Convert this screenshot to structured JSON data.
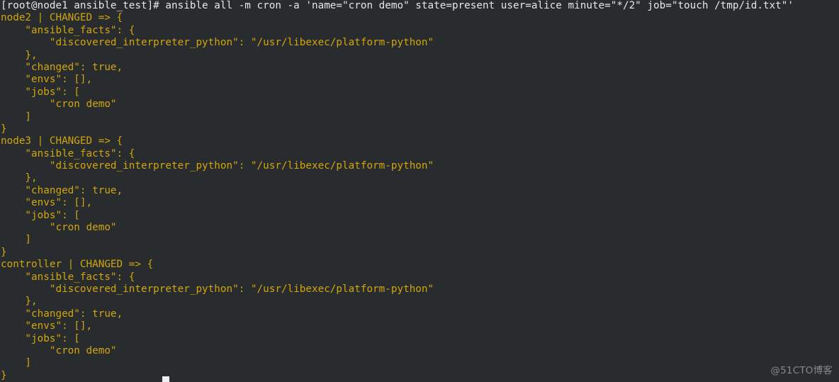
{
  "terminal": {
    "background_color": "#282c2e",
    "prompt_color": "#e6e8e6",
    "output_color": "#d2a50d",
    "prompt_line": "[root@node1 ansible_test]# ansible all -m cron -a 'name=\"cron demo\" state=present user=alice minute=\"*/2\" job=\"touch /tmp/id.txt\"'",
    "prompt": {
      "user": "root",
      "host": "node1",
      "directory": "ansible_test",
      "symbol": "#",
      "command": "ansible all -m cron -a 'name=\"cron demo\" state=present user=alice minute=\"*/2\" job=\"touch /tmp/id.txt\"'"
    },
    "output_lines": [
      "node2 | CHANGED => {",
      "    \"ansible_facts\": {",
      "        \"discovered_interpreter_python\": \"/usr/libexec/platform-python\"",
      "    },",
      "    \"changed\": true,",
      "    \"envs\": [],",
      "    \"jobs\": [",
      "        \"cron demo\"",
      "    ]",
      "}",
      "node3 | CHANGED => {",
      "    \"ansible_facts\": {",
      "        \"discovered_interpreter_python\": \"/usr/libexec/platform-python\"",
      "    },",
      "    \"changed\": true,",
      "    \"envs\": [],",
      "    \"jobs\": [",
      "        \"cron demo\"",
      "    ]",
      "}",
      "controller | CHANGED => {",
      "    \"ansible_facts\": {",
      "        \"discovered_interpreter_python\": \"/usr/libexec/platform-python\"",
      "    },",
      "    \"changed\": true,",
      "    \"envs\": [],",
      "    \"jobs\": [",
      "        \"cron demo\"",
      "    ]",
      "}"
    ],
    "hosts": [
      {
        "name": "node2",
        "status": "CHANGED",
        "ansible_facts": {
          "discovered_interpreter_python": "/usr/libexec/platform-python"
        },
        "changed": "true",
        "envs": "[]",
        "jobs": [
          "cron demo"
        ]
      },
      {
        "name": "node3",
        "status": "CHANGED",
        "ansible_facts": {
          "discovered_interpreter_python": "/usr/libexec/platform-python"
        },
        "changed": "true",
        "envs": "[]",
        "jobs": [
          "cron demo"
        ]
      },
      {
        "name": "controller",
        "status": "CHANGED",
        "ansible_facts": {
          "discovered_interpreter_python": "/usr/libexec/platform-python"
        },
        "changed": "true",
        "envs": "[]",
        "jobs": [
          "cron demo"
        ]
      }
    ],
    "cursor": {
      "visible": "true",
      "color": "#eceff1"
    }
  },
  "watermark": {
    "text": "@51CTO博客",
    "color": "#85888c"
  }
}
